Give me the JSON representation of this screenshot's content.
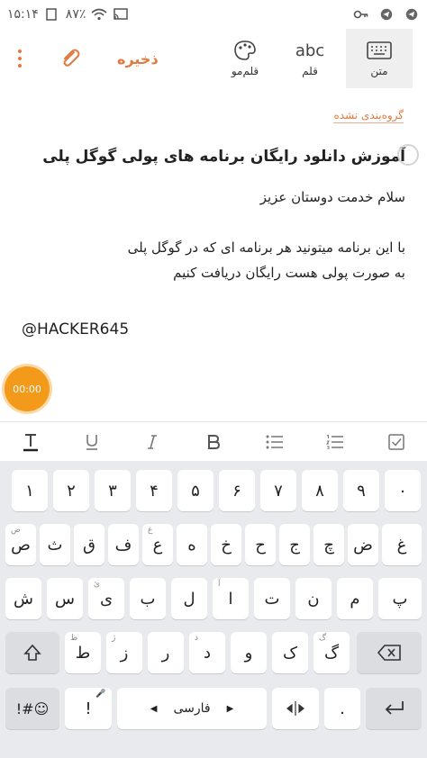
{
  "status": {
    "time": "۱۵:۱۴",
    "battery": "۸۷٪"
  },
  "toolbar": {
    "save_label": "ذخیره",
    "modes": [
      {
        "label": "متن",
        "glyph": "keyboard-icon",
        "active": true
      },
      {
        "label": "قلم",
        "glyph": "abc",
        "active": false
      },
      {
        "label": "قلم‌مو",
        "glyph": "palette-icon",
        "active": false
      }
    ]
  },
  "note": {
    "category": "گروه‌بندی نشده",
    "title": "آموزش دانلود رایگان برنامه های پولی گوگل پلی",
    "body": [
      "سلام خدمت دوستان عزیز",
      "",
      "با این برنامه میتونید هر برنامه ای که در گوگل پلی",
      "به صورت پولی هست رایگان دریافت کنیم"
    ],
    "signature": "@HACKER645"
  },
  "recorder": {
    "time": "00:00"
  },
  "format_bar": [
    "text-style-icon",
    "underline-icon",
    "italic-icon",
    "bold-icon",
    "bullet-list-icon",
    "numbered-list-icon",
    "checkbox-icon"
  ],
  "keyboard": {
    "row1": [
      "۱",
      "۲",
      "۳",
      "۴",
      "۵",
      "۶",
      "۷",
      "۸",
      "۹",
      "۰"
    ],
    "row2": [
      "ض",
      "ص",
      "ث",
      "ق",
      "ف",
      "غ",
      "ع",
      "ه",
      "خ",
      "ح",
      "ج",
      "چ"
    ],
    "row3": [
      "ش",
      "س",
      "ی",
      "ب",
      "ل",
      "ا",
      "ت",
      "ن",
      "م",
      "پ"
    ],
    "row4": [
      "ظ",
      "ط",
      "ز",
      "ر",
      "ذ",
      "د",
      "و",
      "ک",
      "گ"
    ],
    "hints": {
      "ض": "ض",
      "غ": "غ",
      "ی": "ئ",
      "ا": "آ",
      "ظ": "ظ",
      "ز": "ژ",
      "ذ": "ذ",
      "گ": "گ"
    },
    "space_label": "فارسی",
    "symbols_label": "!#☺",
    "punct_label": "!",
    "period_label": "."
  }
}
